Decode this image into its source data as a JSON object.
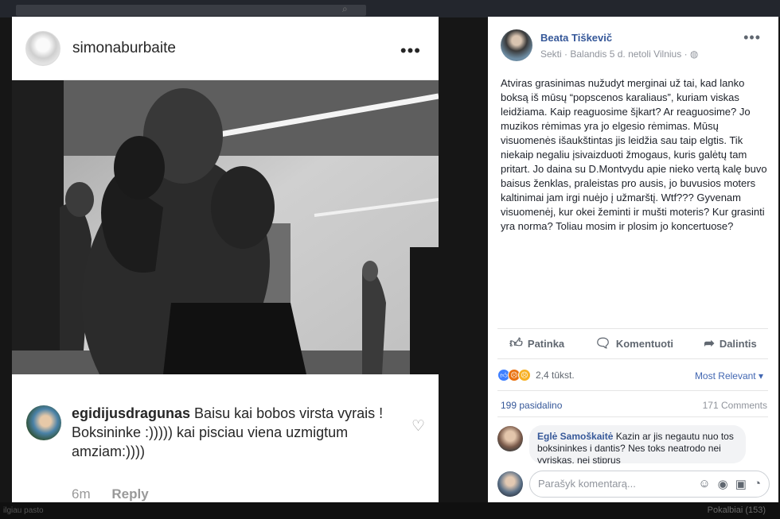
{
  "topbar": {
    "left_bottom_text": "ilgiau pasto",
    "chat_label": "Pokalbiai (153)"
  },
  "instagram": {
    "username": "simonaburbaite",
    "more_label": "•••",
    "comment": {
      "author": "egidijusdragunas",
      "text": "Baisu kai bobos virsta vyrais ! Boksininke :))))) kai pisciau viena uzmigtum amziam:))))",
      "time": "6m",
      "reply_label": "Reply"
    }
  },
  "facebook": {
    "author": "Beata Tiškevič",
    "follow_label": "Sekti",
    "date_location": "· Balandis 5 d. netoli Vilnius ·",
    "more_label": "•••",
    "body": "Atviras grasinimas nužudyt merginai už tai, kad lanko boksą iš mūsų “popscenos karaliaus”, kuriam viskas leidžiama. Kaip reaguosime šįkart? Ar reaguosime? Jo muzikos rėmimas yra jo elgesio rėmimas. Mūsų visuomenės išaukštintas jis leidžia sau taip elgtis. Tik niekaip negaliu įsivaizduoti žmogaus, kuris galėtų tam pritart. Jo daina su D.Montvydu apie nieko vertą kalę buvo baisus ženklas, praleistas pro ausis, jo buvusios moters kaltinimai jam irgi nuėjo į užmarštį. Wtf??? Gyvenam visuomenėj, kur okei žeminti ir mušti moteris? Kur grasinti yra norma? Toliau mosim ir plosim jo koncertuose?",
    "actions": {
      "like": "Patinka",
      "comment": "Komentuoti",
      "share": "Dalintis"
    },
    "reactions_count": "2,4 tūkst.",
    "sort_label": "Most Relevant ▾",
    "shares": "199 pasidalino",
    "comments_count": "171 Comments",
    "top_comment": {
      "author": "Eglė Samoškaitė",
      "text": "Kazin ar jis negautu nuo tos boksininkes i dantis? Nes toks neatrodo nei vyriskas, nei stiprus"
    },
    "write_placeholder": "Parašyk komentarą..."
  }
}
